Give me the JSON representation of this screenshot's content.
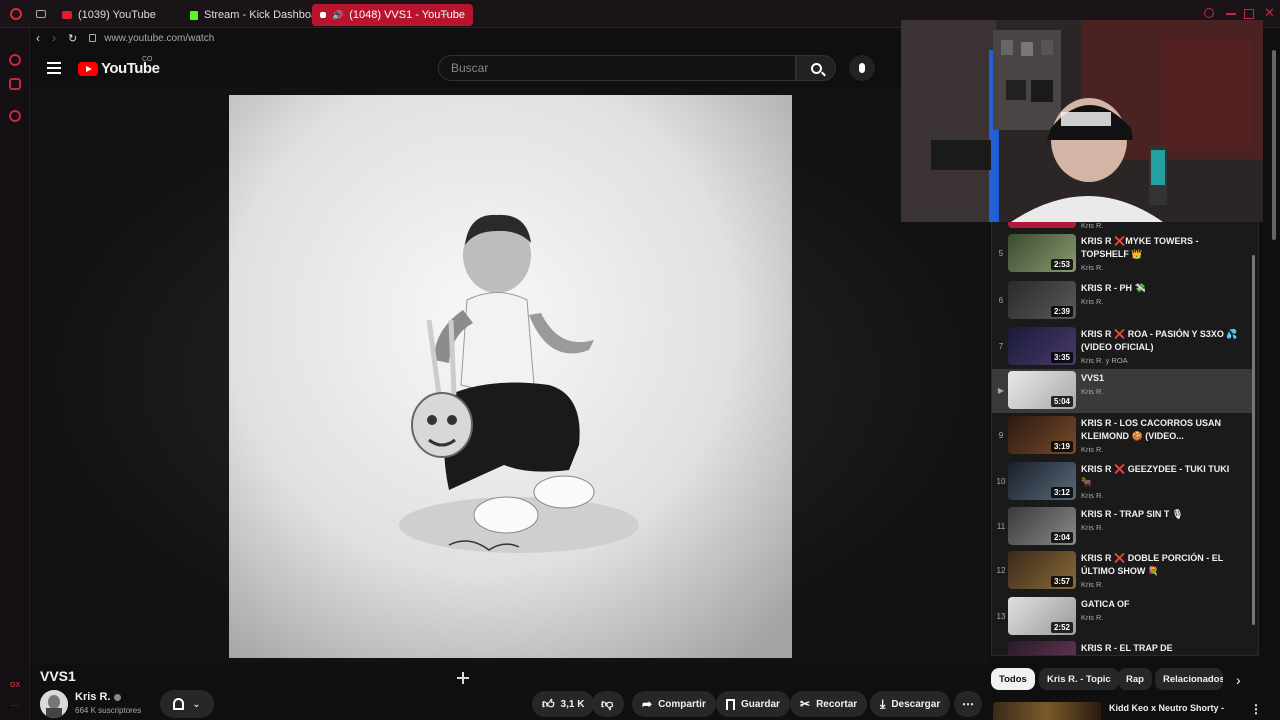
{
  "browser": {
    "tabs": [
      {
        "label": "(1039) YouTube"
      },
      {
        "label": "Stream - Kick Dashboard"
      },
      {
        "label": "(1048) VVS1 - YouTube"
      }
    ],
    "url": "www.youtube.com/watch",
    "sidebar_badge": "GX"
  },
  "header": {
    "logo": "YouTube",
    "country": "CO",
    "search_placeholder": "Buscar"
  },
  "video": {
    "title": "VVS1",
    "channel": "Kris R.",
    "subscribers": "664 K suscriptores",
    "likes": "3,1 K",
    "actions": {
      "share": "Compartir",
      "save": "Guardar",
      "clip": "Recortar",
      "download": "Descargar"
    }
  },
  "playlist": {
    "top_channel": "Kris R.",
    "items": [
      {
        "index": "5",
        "title": "KRIS R ❌MYKE TOWERS - TOPSHELF 👑",
        "channel": "Kris R.",
        "duration": "2:53"
      },
      {
        "index": "6",
        "title": "KRIS R - PH 💸",
        "channel": "Kris R.",
        "duration": "2:39"
      },
      {
        "index": "7",
        "title": "KRIS R ❌ ROA - PASIÓN Y S3XO 💦 (VIDEO OFICIAL)",
        "channel": "Kris R. y ROA",
        "duration": "3:35"
      },
      {
        "index": "▶",
        "title": "VVS1",
        "channel": "Kris R.",
        "duration": "5:04"
      },
      {
        "index": "9",
        "title": "KRIS R - LOS CACORROS USAN KLEIMOND 🍪 (VIDEO...",
        "channel": "Kris R.",
        "duration": "3:19"
      },
      {
        "index": "10",
        "title": "KRIS R ❌ GEEZYDEE - TUKI TUKI 🐂",
        "channel": "Kris R.",
        "duration": "3:12"
      },
      {
        "index": "11",
        "title": "KRIS R - TRAP SIN T 🎙",
        "channel": "Kris R.",
        "duration": "2:04"
      },
      {
        "index": "12",
        "title": "KRIS R ❌ DOBLE PORCIÓN - EL ÚLTIMO SHOW 💐",
        "channel": "Kris R.",
        "duration": "3:57"
      },
      {
        "index": "13",
        "title": "GATICA OF",
        "channel": "Kris R.",
        "duration": "2:52"
      },
      {
        "index": "",
        "title": "KRIS R - EL TRAP DE",
        "channel": "",
        "duration": ""
      }
    ]
  },
  "chips": [
    "Todos",
    "Kris R. - Topic",
    "Rap",
    "Relacionados"
  ],
  "next_video": {
    "title": "Kidd Keo x Neutro Shorty -"
  },
  "colors": {
    "accent": "#ff0000",
    "active_tab": "#b8142e",
    "background": "#0f0f0f"
  }
}
